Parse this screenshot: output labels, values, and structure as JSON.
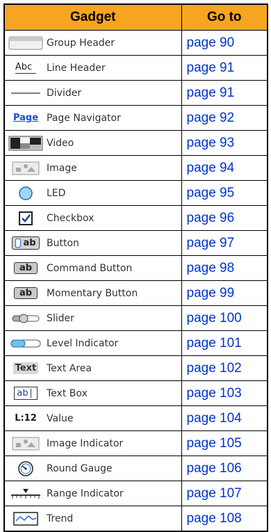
{
  "header": {
    "gadget": "Gadget",
    "goto": "Go to"
  },
  "rows": [
    {
      "label": "Group Header",
      "page": "page 90",
      "icon": "group-header-icon"
    },
    {
      "label": "Line Header",
      "page": "page 91",
      "icon": "line-header-icon",
      "icon_text": "Abc"
    },
    {
      "label": "Divider",
      "page": "page 91",
      "icon": "divider-icon"
    },
    {
      "label": "Page Navigator",
      "page": "page 92",
      "icon": "page-navigator-icon",
      "icon_text": "Page"
    },
    {
      "label": "Video",
      "page": "page 93",
      "icon": "video-icon"
    },
    {
      "label": "Image",
      "page": "page 94",
      "icon": "image-icon"
    },
    {
      "label": "LED",
      "page": "page 95",
      "icon": "led-icon"
    },
    {
      "label": "Checkbox",
      "page": "page 96",
      "icon": "checkbox-icon"
    },
    {
      "label": "Button",
      "page": "page 97",
      "icon": "button-icon",
      "icon_text": "ab"
    },
    {
      "label": "Command Button",
      "page": "page 98",
      "icon": "command-button-icon",
      "icon_text": "ab"
    },
    {
      "label": "Momentary Button",
      "page": "page 99",
      "icon": "momentary-button-icon",
      "icon_text": "ab"
    },
    {
      "label": "Slider",
      "page": "page 100",
      "icon": "slider-icon"
    },
    {
      "label": "Level Indicator",
      "page": "page 101",
      "icon": "level-indicator-icon"
    },
    {
      "label": "Text Area",
      "page": "page 102",
      "icon": "text-area-icon",
      "icon_text": "Text"
    },
    {
      "label": "Text Box",
      "page": "page 103",
      "icon": "text-box-icon",
      "icon_text": "ab"
    },
    {
      "label": "Value",
      "page": "page 104",
      "icon": "value-icon",
      "icon_text": "L:12"
    },
    {
      "label": "Image Indicator",
      "page": "page 105",
      "icon": "image-indicator-icon"
    },
    {
      "label": "Round Gauge",
      "page": "page 106",
      "icon": "round-gauge-icon"
    },
    {
      "label": "Range Indicator",
      "page": "page 107",
      "icon": "range-indicator-icon"
    },
    {
      "label": "Trend",
      "page": "page 108",
      "icon": "trend-icon"
    }
  ],
  "colors": {
    "header_bg": "#f7a520",
    "link": "#0033cc",
    "icon_blue": "#1e6fd9",
    "led": "#9ed6f7"
  }
}
